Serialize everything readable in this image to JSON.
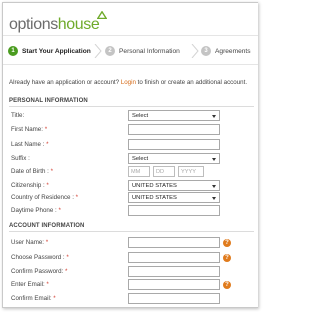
{
  "brand": {
    "name_part1": "options",
    "name_part2": "house",
    "primary_color": "#6faa2a",
    "gray_color": "#6c6c6c"
  },
  "steps": [
    {
      "number": "1",
      "label": "Start Your Application",
      "state": "active"
    },
    {
      "number": "2",
      "label": "Personal Information",
      "state": "inactive"
    },
    {
      "number": "3",
      "label": "Agreements",
      "state": "inactive"
    }
  ],
  "notice": {
    "before": "Already have an application or account? ",
    "link": "Login",
    "after": " to finish or create an additional account."
  },
  "personal": {
    "title": "PERSONAL INFORMATION",
    "fields": {
      "title": {
        "label": "Title:",
        "value": "Select"
      },
      "first_name": {
        "label": "First Name: ",
        "value": ""
      },
      "last_name": {
        "label": "Last Name : ",
        "value": ""
      },
      "suffix": {
        "label": "Suffix : ",
        "value": "Select"
      },
      "dob": {
        "label": "Date of Birth : ",
        "mm": "MM",
        "dd": "DD",
        "yyyy": "YYYY"
      },
      "citizenship": {
        "label": "Citizenship : ",
        "value": "UNITED STATES"
      },
      "residence": {
        "label": "Country of Residence : ",
        "value": "UNITED STATES"
      },
      "phone": {
        "label": "Daytime Phone : ",
        "value": ""
      }
    }
  },
  "account": {
    "title": "ACCOUNT INFORMATION",
    "fields": {
      "username": {
        "label": "User Name: ",
        "value": ""
      },
      "password": {
        "label": "Choose Password : ",
        "value": ""
      },
      "confirm_password": {
        "label": "Confirm Password: ",
        "value": ""
      },
      "email": {
        "label": "Enter Email: ",
        "value": ""
      },
      "confirm_email": {
        "label": "Confirm Email: ",
        "value": ""
      }
    }
  },
  "required_mark": "*",
  "help_glyph": "?",
  "icons": {
    "help": "help-icon",
    "step_separator": "chevron-right-icon",
    "logo_mark": "triangle-logo-icon"
  }
}
